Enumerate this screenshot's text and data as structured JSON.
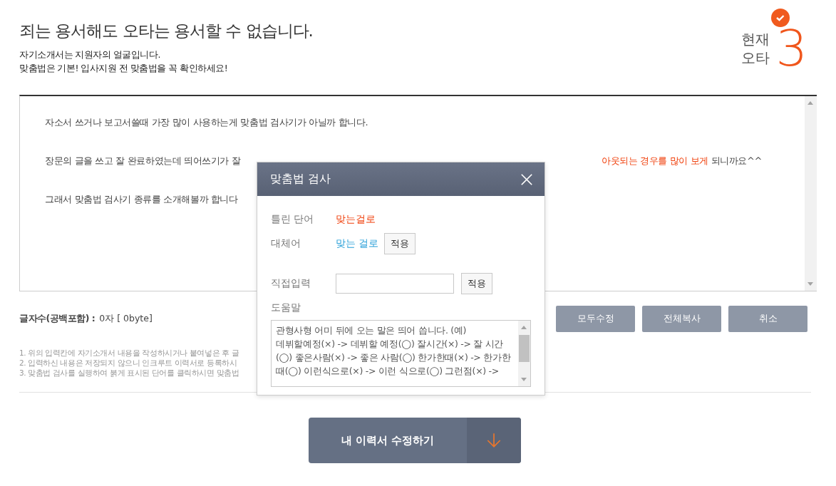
{
  "header": {
    "title": "죄는 용서해도 오타는 용서할 수 없습니다.",
    "subtitle_lines": [
      "자기소개서는 지원자의 얼굴입니다.",
      "맞춤법은 기본! 입사지원 전 맞춤법을 꼭 확인하세요!"
    ]
  },
  "error_counter": {
    "label_lines": [
      "현재",
      "오타"
    ],
    "count": "3"
  },
  "editor": {
    "lines": [
      {
        "segments": [
          {
            "text": "자소서 쓰거나 보고서쓸때 가장 많이 사용하는게 맞춤법 검사기가 아닐까 합니다.",
            "error": false
          }
        ]
      },
      {
        "segments": [
          {
            "text": "장문의 글을 쓰고 잘 완료하였는데 띄어쓰기가 잘",
            "error": false
          },
          {
            "text": "아웃되는 경우를 많이 보게",
            "error": true
          },
          {
            "text": " 되니까요^^",
            "error": false
          }
        ]
      },
      {
        "segments": [
          {
            "text": "그래서 맞춤법 검사기 종류를 소개해볼까 합니다",
            "error": false
          }
        ]
      }
    ]
  },
  "char_count": {
    "label": "글자수(공백포함) :",
    "value": "0자 [ 0byte]"
  },
  "actions": [
    "모두수정",
    "전체복사",
    "취소"
  ],
  "notes": [
    "1. 위의 입력칸에 자기소개서 내용을 작성하시거나 붙여넣은 후 글",
    "2. 입력하신 내용은 저장되지 않으니 인크루트 이력서로 등록하시",
    "3. 맞춤법 검사를 실행하여 붉게 표시된 단어를 클릭하시면 맞춤법"
  ],
  "dialog": {
    "title": "맞춤법 검사",
    "wrong_label": "틀린 단어",
    "wrong_word": "맞는걸로",
    "replace_label": "대체어",
    "replacement": "맞는 걸로",
    "apply": "적용",
    "direct_label": "직접입력",
    "direct_apply": "적용",
    "help_label": "도움말",
    "help_text": "관형사형 어미 뒤에 오는 말은 띄어 씁니다. (예) 데뷔할예정(×) -> 데뷔할 예정(◯) 잘시간(×) -> 잘 시간(◯) 좋은사람(×) -> 좋은 사람(◯) 한가한때(×) -> 한가한 때(◯) 이런식으로(×) -> 이런 식으로(◯) 그런점(×) ->"
  },
  "main_button": {
    "label": "내 이력서 수정하기"
  }
}
